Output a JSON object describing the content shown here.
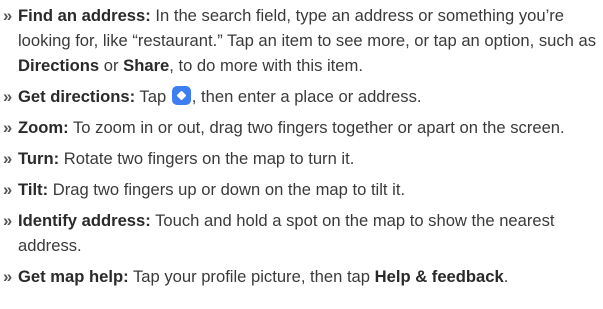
{
  "bullet": "»",
  "items": [
    {
      "term": "Find an address:",
      "text1": " In the search field, type an address or something you’re looking for, like “restaurant.” Tap an item to see more, or tap an option, such as ",
      "kw1": "Directions",
      "text2": " or ",
      "kw2": "Share",
      "text3": ", to do more with this item."
    },
    {
      "term": "Get directions:",
      "text1": " Tap ",
      "icon": "directions-icon",
      "text2": ", then enter a place or address."
    },
    {
      "term": "Zoom:",
      "text1": " To zoom in or out, drag two fingers together or apart on the screen."
    },
    {
      "term": "Turn:",
      "text1": " Rotate two fingers on the map to turn it."
    },
    {
      "term": "Tilt:",
      "text1": " Drag two fingers up or down on the map to tilt it."
    },
    {
      "term": "Identify address:",
      "text1": " Touch and hold a spot on the map to show the nearest address."
    },
    {
      "term": "Get map help:",
      "text1": " Tap your profile picture, then tap ",
      "kw1": "Help & feedback",
      "text2": "."
    }
  ],
  "colors": {
    "icon_bg": "#3d7ff3",
    "text": "#3a3a3a"
  }
}
